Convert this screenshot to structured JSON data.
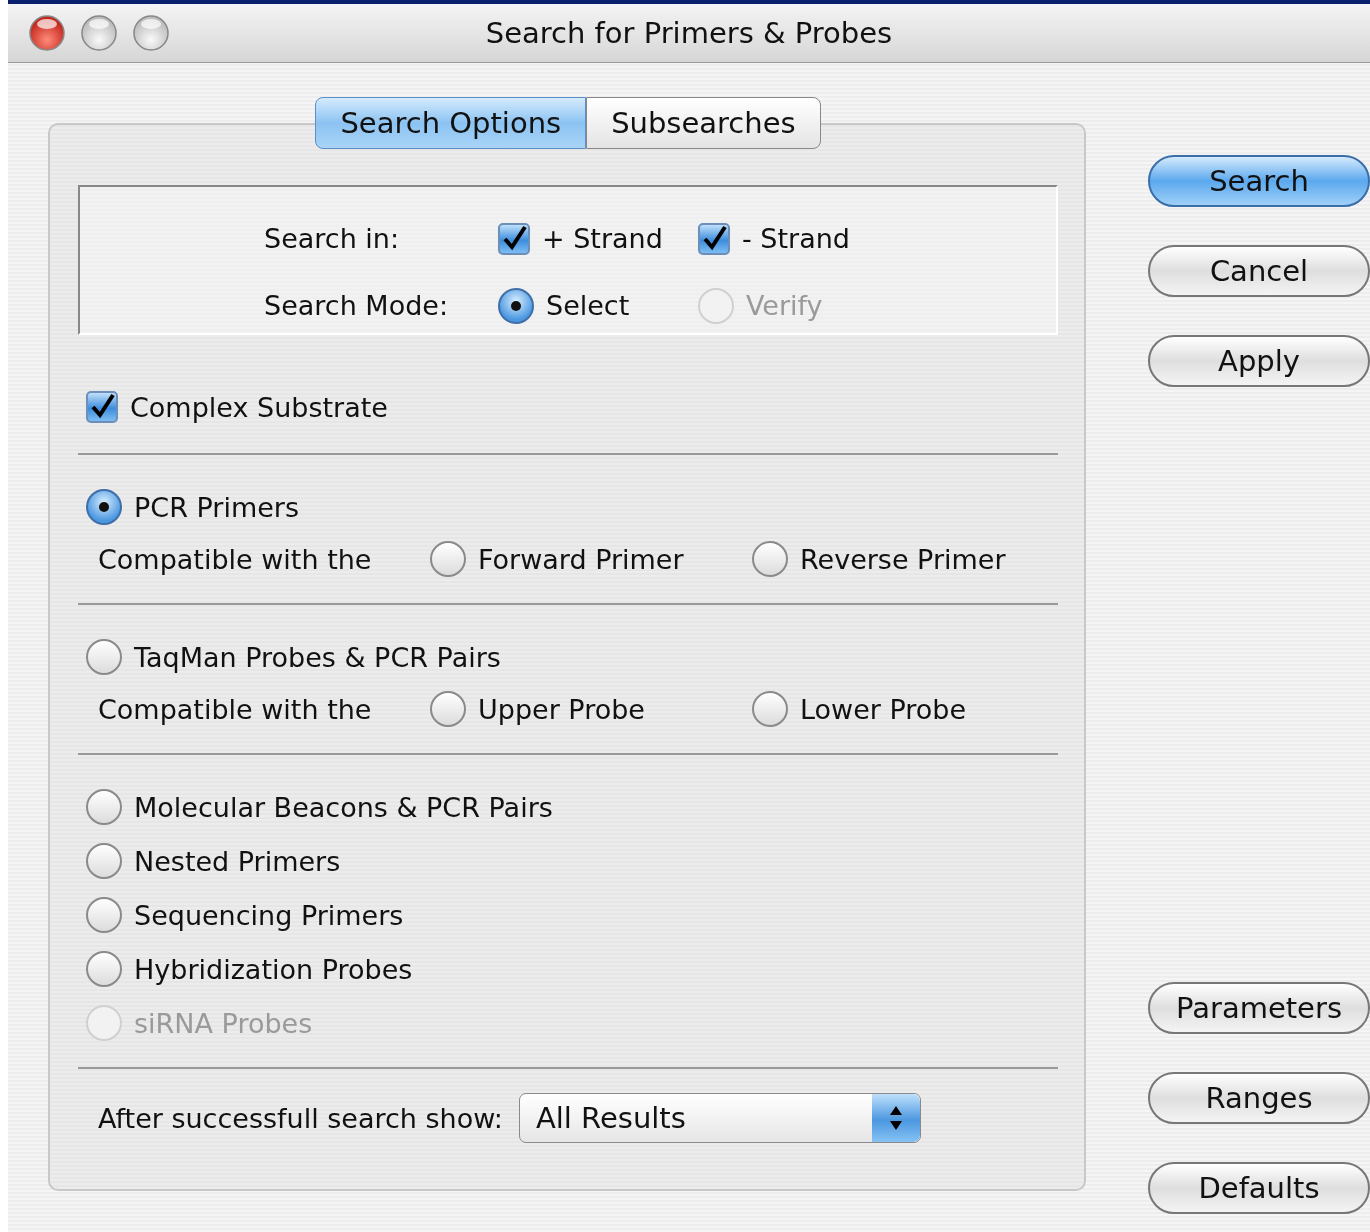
{
  "window": {
    "title": "Search for Primers & Probes"
  },
  "tabs": [
    {
      "label": "Search Options",
      "selected": true
    },
    {
      "label": "Subsearches",
      "selected": false
    }
  ],
  "search_in": {
    "label": "Search in:",
    "options": [
      {
        "label": "+ Strand",
        "checked": true
      },
      {
        "label": "- Strand",
        "checked": true
      }
    ]
  },
  "search_mode": {
    "label": "Search Mode:",
    "options": [
      {
        "label": "Select",
        "selected": true,
        "disabled": false
      },
      {
        "label": "Verify",
        "selected": false,
        "disabled": true
      }
    ]
  },
  "complex_substrate": {
    "label": "Complex Substrate",
    "checked": true
  },
  "search_type_groups": [
    {
      "items": [
        {
          "label": "PCR Primers",
          "selected": true,
          "disabled": false,
          "compatible": {
            "label": "Compatible with the",
            "options": [
              {
                "label": "Forward Primer",
                "selected": false
              },
              {
                "label": "Reverse Primer",
                "selected": false
              }
            ]
          }
        }
      ]
    },
    {
      "items": [
        {
          "label": "TaqMan Probes & PCR Pairs",
          "selected": false,
          "disabled": false,
          "compatible": {
            "label": "Compatible with the",
            "options": [
              {
                "label": "Upper Probe",
                "selected": false
              },
              {
                "label": "Lower Probe",
                "selected": false
              }
            ]
          }
        }
      ]
    },
    {
      "items": [
        {
          "label": "Molecular Beacons & PCR Pairs",
          "selected": false,
          "disabled": false
        },
        {
          "label": "Nested Primers",
          "selected": false,
          "disabled": false
        },
        {
          "label": "Sequencing Primers",
          "selected": false,
          "disabled": false
        },
        {
          "label": "Hybridization Probes",
          "selected": false,
          "disabled": false
        },
        {
          "label": "siRNA Probes",
          "selected": false,
          "disabled": true
        }
      ]
    }
  ],
  "result_display": {
    "label": "After successfull search show:",
    "value": "All Results"
  },
  "action_buttons": [
    {
      "label": "Search",
      "default": true
    },
    {
      "label": "Cancel",
      "default": false
    },
    {
      "label": "Apply",
      "default": false
    }
  ],
  "setting_buttons": [
    {
      "label": "Parameters",
      "default": false
    },
    {
      "label": "Ranges",
      "default": false
    },
    {
      "label": "Defaults",
      "default": false
    }
  ]
}
